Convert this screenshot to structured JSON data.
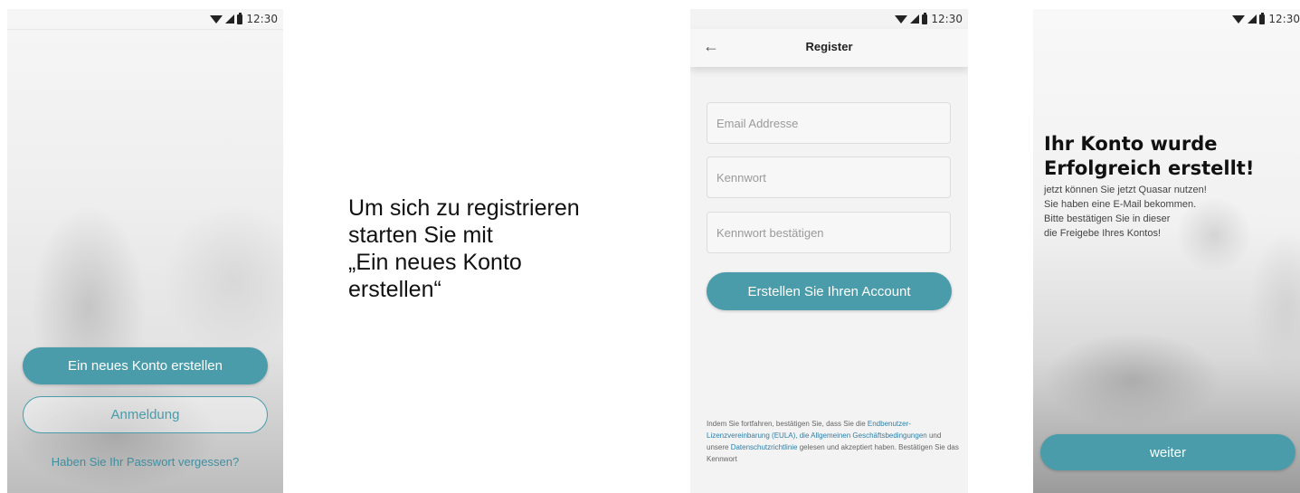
{
  "status_time": "12:30",
  "screen1": {
    "create_account_label": "Ein neues Konto erstellen",
    "login_label": "Anmeldung",
    "forgot_password_label": "Haben Sie Ihr Passwort vergessen?"
  },
  "instruction": "Um sich zu registrieren\nstarten Sie mit\n„Ein neues Konto\nerstellen“",
  "screen2": {
    "title": "Register",
    "email_placeholder": "Email Addresse",
    "password_placeholder": "Kennwort",
    "confirm_placeholder": "Kennwort bestätigen",
    "create_button_label": "Erstellen Sie Ihren Account",
    "legal": {
      "part1": "Indem Sie fortfahren, bestätigen Sie, dass Sie die ",
      "eula_link": "Endbenutzer-Lizenzvereinbarung (EULA), die Allgemeinen Geschäftsbedingungen",
      "part2": " und unsere ",
      "privacy_link": "Datenschutzrichtlinie",
      "part3": " gelesen und akzeptiert haben. Bestätigen Sie das Kennwort"
    }
  },
  "screen3": {
    "title": "Ihr Konto wurde Erfolgreich erstellt!",
    "body_lines": [
      "jetzt können Sie jetzt Quasar nutzen!",
      "Sie haben eine E-Mail bekommen.",
      "Bitte bestätigen Sie in dieser",
      "die Freigebe Ihres Kontos!"
    ],
    "continue_label": "weiter"
  },
  "colors": {
    "accent": "#4a9cab",
    "link": "#2f7fa8"
  }
}
